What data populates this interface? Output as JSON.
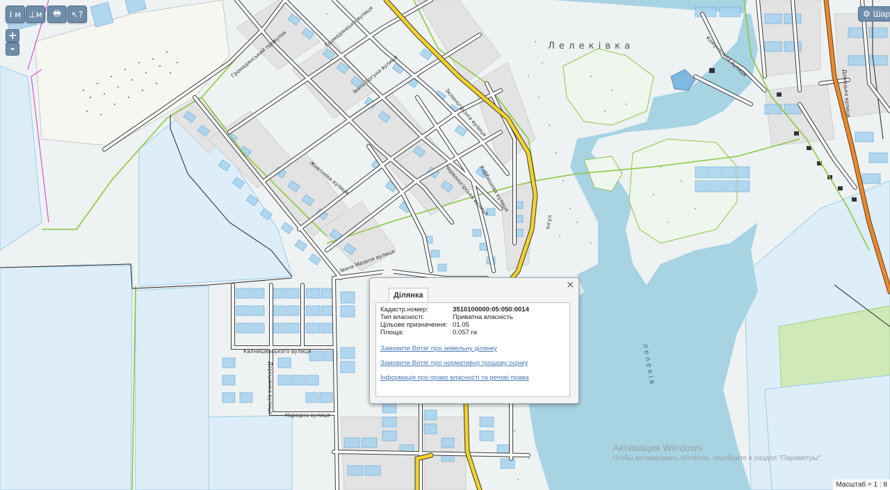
{
  "toolbar": {
    "buttons": [
      {
        "name": "measure-length-button",
        "label": "I м"
      },
      {
        "name": "measure-area-button",
        "label": "⊥м"
      },
      {
        "name": "print-button",
        "label": "🖶"
      },
      {
        "name": "info-cursor-button",
        "label": "↖?"
      }
    ],
    "zoom_in": "+",
    "zoom_out": "-",
    "layers_label": "Шар"
  },
  "map": {
    "labels": {
      "village": "Л е л е к і в к а",
      "street_hromadianska": "Громадянська вулиця",
      "street_hromadianskyi_prov": "Громадянський провулок",
      "street_ivana_bohuna": "Івана Богуна вулиця",
      "street_zelenohirska": "Зеленогірська вулиця",
      "street_zhovtneva": "Жовтнева вулиця",
      "street_chervonohirska": "Червоногірська вулиця",
      "street_karbysheva": "Карбишева вулиця",
      "street_ivana_mazepy": "Івана Мазепи вулиця",
      "street_kalnyshevskoho": "Калнишевського вулиця",
      "street_doroshenka": "Дорошенка вулиця",
      "street_narodna": "Народна вулиця",
      "street_komunalna": "Комунальна вулиця",
      "street_ingul": "Інгул",
      "river_lelekivka": "л е л е к і в",
      "street_donetska_right": "Донецька вулиця"
    }
  },
  "popup": {
    "tab_label": "Ділянка",
    "close": "×",
    "fields": [
      {
        "key": "Кадастр.номер:",
        "value": "3510100000:05:050:0014",
        "bold": true
      },
      {
        "key": "Тип власності:",
        "value": "Приватна власність",
        "bold": false
      },
      {
        "key": "Цільове призначення:",
        "value": "01.05",
        "bold": false
      },
      {
        "key": "Площа:",
        "value": "0.057 га",
        "bold": false
      }
    ],
    "links": [
      "Замовити Витяг про земельну ділянку",
      "Замовити Витяг про нормативну грошову оцінку",
      "Інформація про право власності та речові права"
    ]
  },
  "scale_label": "Масштаб = 1 : 8",
  "watermark": {
    "title": "Активация Windows",
    "subtitle": "Чтобы активировать Windows, перейдите в раздел \"Параметры\"."
  },
  "colors": {
    "water": "#a7d3e3",
    "field": "#ddeef8",
    "parcel": "#a6d2ef",
    "road": "#ffffff",
    "road_outline": "#3a3a3a",
    "main_road": "#f2d22a",
    "highway": "#e8892f",
    "boundary": "#8cc63e",
    "meadow": "#eef6ee"
  }
}
